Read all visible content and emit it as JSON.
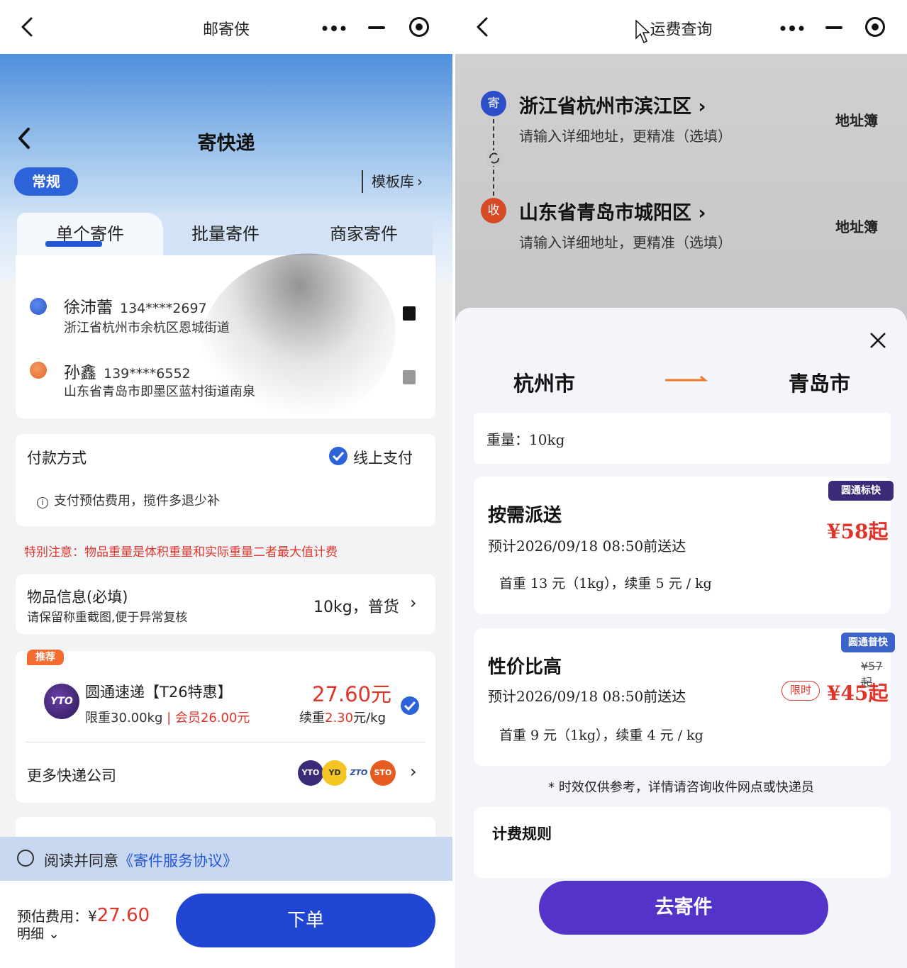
{
  "left": {
    "window_title": "邮寄侠",
    "page_title": "寄快递",
    "mode_pill": "常规",
    "template_link": "模板库",
    "tabs": [
      "单个寄件",
      "批量寄件",
      "商家寄件"
    ],
    "sender": {
      "name": "徐沛蕾",
      "phone": "134****2697",
      "address": "浙江省杭州市余杭区恩城街道"
    },
    "receiver": {
      "name": "孙鑫",
      "phone": "139****6552",
      "address": "山东省青岛市即墨区蓝村街道南泉"
    },
    "payment": {
      "label": "付款方式",
      "method": "线上支付",
      "note": "支付预估费用，揽件多退少补"
    },
    "warning": "特别注意：物品重量是体积重量和实际重量二者最大值计费",
    "item": {
      "title": "物品信息(必填)",
      "subtitle": "请保留称重截图,便于异常复核",
      "value": "10kg，普货"
    },
    "carrier": {
      "tag": "推荐",
      "logo": "YTO",
      "name": "圆通速递【T26特惠】",
      "limit": "限重30.00kg",
      "member_price": "会员26.00元",
      "price": "27.60元",
      "extra_prefix": "续重",
      "extra_value": "2.30",
      "extra_unit": "元/kg"
    },
    "more_carriers": {
      "label": "更多快递公司",
      "logos": [
        "YTO",
        "YD",
        "ZTO",
        "STO"
      ]
    },
    "agreement": {
      "prefix": "阅读并同意",
      "link": "《寄件服务协议》"
    },
    "estimate": {
      "label": "预估费用：",
      "currency": "¥",
      "amount": "27.60",
      "detail": "明细"
    },
    "order_button": "下单",
    "colors": {
      "primary": "#2146d4",
      "warning": "#e0342a"
    }
  },
  "right": {
    "window_title": "运费查询",
    "sender_badge": "寄",
    "receiver_badge": "收",
    "origin": "浙江省杭州市滨江区",
    "origin_hint": "请输入详细地址，更精准（选填）",
    "destination": "山东省青岛市城阳区",
    "destination_hint": "请输入详细地址，更精准（选填）",
    "address_book": "地址簿",
    "from_city": "杭州市",
    "to_city": "青岛市",
    "weight_label": "重量：",
    "weight_value": "10kg",
    "services": [
      {
        "tag": "圆通标快",
        "title": "按需派送",
        "eta": "预计2026/09/18 08:50前送达",
        "price": "¥58起",
        "rate": "首重 13 元（1kg），续重 5 元 / kg"
      },
      {
        "tag": "圆通普快",
        "title": "性价比高",
        "eta": "预计2026/09/18 08:50前送达",
        "original_price": "¥57起",
        "limit_tag": "限时",
        "price": "¥45起",
        "rate": "首重 9 元（1kg），续重 4 元 / kg"
      }
    ],
    "note": "* 时效仅供参考，详情请咨询收件网点或快递员",
    "rules_title": "计费规则",
    "go_button": "去寄件",
    "colors": {
      "go_button": "#5433c9",
      "price": "#e0342a"
    }
  }
}
